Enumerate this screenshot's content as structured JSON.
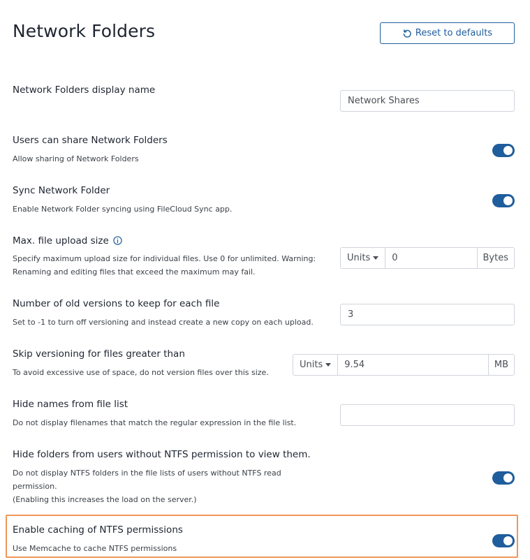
{
  "header": {
    "title": "Network Folders",
    "reset_label": "Reset to defaults"
  },
  "settings": {
    "display_name": {
      "label": "Network Folders display name",
      "value": "Network Shares"
    },
    "users_share": {
      "label": "Users can share Network Folders",
      "description": "Allow sharing of Network Folders",
      "enabled": true
    },
    "sync": {
      "label": "Sync Network Folder",
      "description": "Enable Network Folder syncing using FileCloud Sync app.",
      "enabled": true
    },
    "max_upload": {
      "label": "Max. file upload size",
      "description_line1": "Specify maximum upload size for individual files. Use 0 for unlimited. Warning:",
      "description_line2": "Renaming and editing files that exceed the maximum may fail.",
      "units_label": "Units",
      "value": "0",
      "suffix": "Bytes"
    },
    "old_versions": {
      "label": "Number of old versions to keep for each file",
      "description": "Set to -1 to turn off versioning and instead create a new copy on each upload.",
      "value": "3"
    },
    "skip_versioning": {
      "label": "Skip versioning for files greater than",
      "description": "To avoid excessive use of space, do not version files over this size.",
      "units_label": "Units",
      "value": "9.54",
      "suffix": "MB"
    },
    "hide_names": {
      "label": "Hide names from file list",
      "description": "Do not display filenames that match the regular expression in the file list.",
      "value": ""
    },
    "hide_folders": {
      "label": "Hide folders from users without NTFS permission to view them.",
      "description_line1": "Do not display NTFS folders in the file lists of users without NTFS read",
      "description_line2": "permission.",
      "description_line3": "(Enabling this increases the load on the server.)",
      "enabled": true
    },
    "ntfs_cache": {
      "label": "Enable caching of NTFS permissions",
      "description": "Use Memcache to cache NTFS permissions",
      "enabled": true
    }
  },
  "colors": {
    "accent": "#1f5d9c",
    "highlight": "#f0965a"
  }
}
